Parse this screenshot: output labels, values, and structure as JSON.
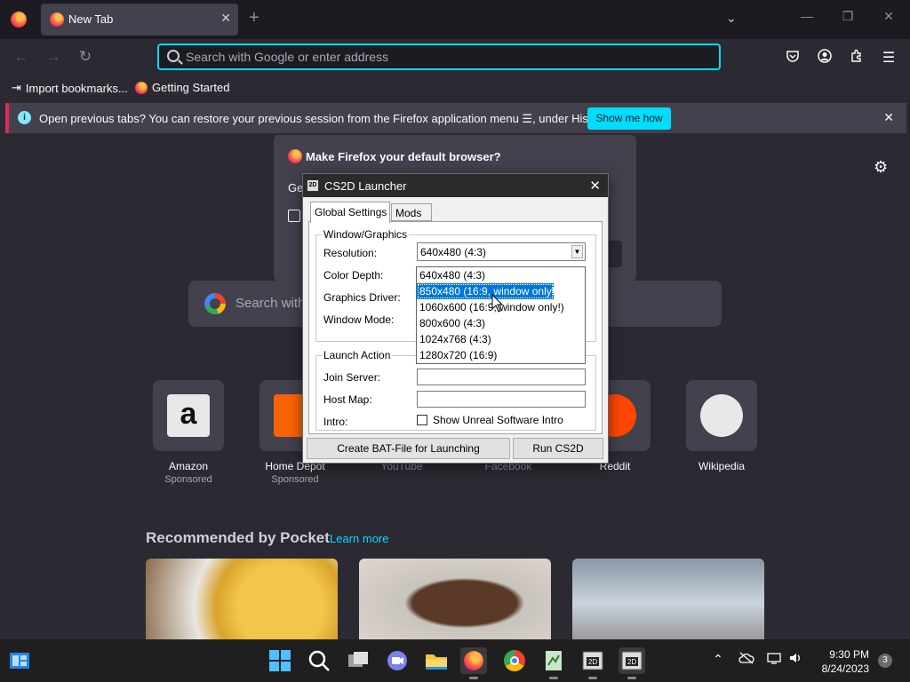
{
  "browser": {
    "tab_title": "New Tab",
    "tab_close": "✕",
    "new_tab": "+",
    "list_tabs": "⌄",
    "window_controls": {
      "minimize": "—",
      "restore": "❐",
      "close": "✕"
    },
    "nav": {
      "back": "←",
      "forward": "→",
      "reload": "↻"
    },
    "search_placeholder": "Search with Google or enter address",
    "toolbar_icons": {
      "pocket": "pocket-icon",
      "account": "account-icon",
      "extensions": "extensions-icon",
      "menu": "☰"
    },
    "bookmarks": [
      {
        "label": "Import bookmarks...",
        "icon": "import-icon"
      },
      {
        "label": "Getting Started",
        "icon": "firefox-icon"
      }
    ]
  },
  "notification": {
    "message": "Open previous tabs? You can restore your previous session from the Firefox application menu ☰, under History.",
    "button": "Show me how",
    "close": "✕"
  },
  "newtab": {
    "settings_icon": "⚙",
    "default_dialog": {
      "title": "Make Firefox your default browser?",
      "text_partial": "Ge"
    },
    "search_placeholder": "Search with",
    "top_sites": [
      {
        "name": "Amazon",
        "sponsored": "Sponsored",
        "color": "#e8e8e8"
      },
      {
        "name": "Home Depot",
        "sponsored": "Sponsored",
        "color": "#f96302"
      },
      {
        "name": "YouTube",
        "sponsored": "",
        "color": "#ff0000"
      },
      {
        "name": "Facebook",
        "sponsored": "",
        "color": "#1877f2"
      },
      {
        "name": "Reddit",
        "sponsored": "",
        "color": "#ff4500"
      },
      {
        "name": "Wikipedia",
        "sponsored": "",
        "color": "#e8e8e8"
      }
    ],
    "pocket": {
      "title": "Recommended by Pocket",
      "learn_more": "Learn more"
    }
  },
  "launcher": {
    "window_title": "CS2D Launcher",
    "close": "✕",
    "tabs": [
      "Global Settings",
      "Mods"
    ],
    "group_graphics": "Window/Graphics",
    "labels": {
      "resolution": "Resolution:",
      "color_depth": "Color Depth:",
      "graphics_driver": "Graphics Driver:",
      "window_mode": "Window Mode:"
    },
    "resolution_value": "640x480 (4:3)",
    "resolution_options": [
      "640x480 (4:3)",
      "850x480 (16:9, window only!)",
      "1060x600 (16:9, window only!)",
      "800x600 (4:3)",
      "1024x768 (4:3)",
      "1280x720 (16:9)"
    ],
    "highlighted_option": "850x480 (16:9, window only!)",
    "group_launch": "Launch Action",
    "join_server": "Join Server:",
    "host_map": "Host Map:",
    "intro": "Intro:",
    "intro_checkbox": "Show Unreal Software Intro",
    "bat_button": "Create BAT-File for Launching",
    "run_button": "Run CS2D"
  },
  "taskbar": {
    "time": "9:30 PM",
    "date": "8/24/2023",
    "notification_count": "3",
    "tray": {
      "chevron": "⌃",
      "network": "network-icon",
      "volume": "volume-icon"
    },
    "apps": [
      "widgets-icon",
      "start-icon",
      "search-icon",
      "task-view-icon",
      "teams-icon",
      "file-explorer-icon",
      "firefox-icon",
      "chrome-icon",
      "notepad-icon",
      "cs2d-icon",
      "cs2d-launcher-icon"
    ]
  }
}
